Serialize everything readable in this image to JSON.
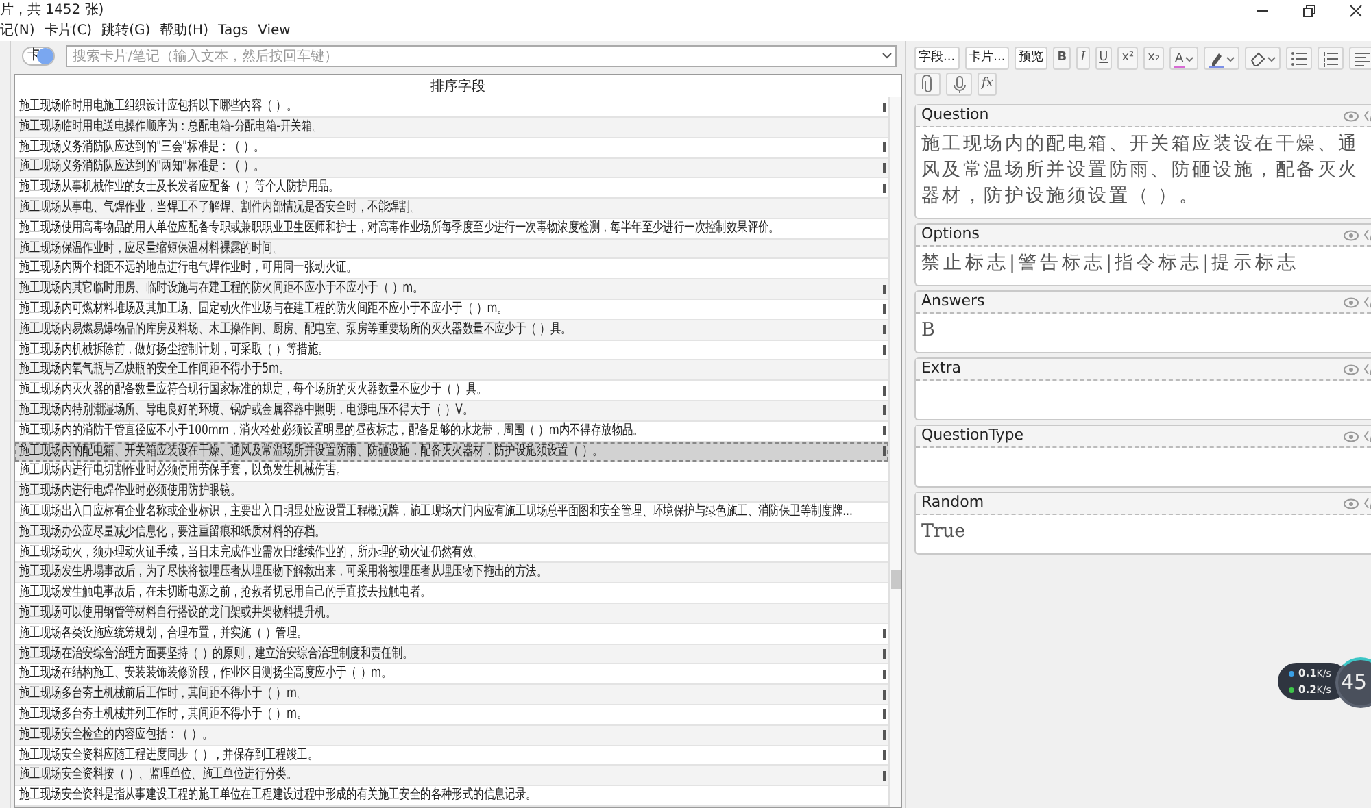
{
  "window": {
    "title": "片，共 1452 张)"
  },
  "menu": [
    {
      "label": "记(N)"
    },
    {
      "label": "卡片(C)"
    },
    {
      "label": "跳转(G)"
    },
    {
      "label": "帮助(H)"
    },
    {
      "label": "Tags"
    },
    {
      "label": "View"
    }
  ],
  "search": {
    "toggle_label": "卡",
    "placeholder": "搜索卡片/笔记（输入文本，然后按回车键）"
  },
  "table": {
    "columns": [
      "排序字段"
    ],
    "rows": [
      {
        "text": "施工现场临时用电施工组织设计应包括以下哪些内容（ ）。",
        "selected": false,
        "marked": true
      },
      {
        "text": "施工现场临时用电送电操作顺序为：总配电箱-分配电箱-开关箱。",
        "selected": false,
        "marked": false
      },
      {
        "text": "施工现场义务消防队应达到的\"三会\"标准是：（ ）。",
        "selected": false,
        "marked": true
      },
      {
        "text": "施工现场义务消防队应达到的\"两知\"标准是：（ ）。",
        "selected": false,
        "marked": true
      },
      {
        "text": "施工现场从事机械作业的女士及长发者应配备（ ）等个人防护用品。",
        "selected": false,
        "marked": true
      },
      {
        "text": "施工现场从事电、气焊作业，当焊工不了解焊、割件内部情况是否安全时，不能焊割。",
        "selected": false,
        "marked": false
      },
      {
        "text": "施工现场使用高毒物品的用人单位应配备专职或兼职职业卫生医师和护士，对高毒作业场所每季度至少进行一次毒物浓度检测，每半年至少进行一次控制效果评价。",
        "selected": false,
        "marked": false
      },
      {
        "text": "施工现场保温作业时，应尽量缩短保温材料裸露的时间。",
        "selected": false,
        "marked": false
      },
      {
        "text": "施工现场内两个相距不远的地点进行电气焊作业时，可用同一张动火证。",
        "selected": false,
        "marked": false
      },
      {
        "text": "施工现场内其它临时用房、临时设施与在建工程的防火间距不应小于不应小于（ ）m。",
        "selected": false,
        "marked": true
      },
      {
        "text": "施工现场内可燃材料堆场及其加工场、固定动火作业场与在建工程的防火间距不应小于不应小于（ ）m。",
        "selected": false,
        "marked": true
      },
      {
        "text": "施工现场内易燃易爆物品的库房及料场、木工操作间、厨房、配电室、泵房等重要场所的灭火器数量不应少于（ ）具。",
        "selected": false,
        "marked": true
      },
      {
        "text": "施工现场内机械拆除前，做好扬尘控制计划，可采取（ ）等措施。",
        "selected": false,
        "marked": true
      },
      {
        "text": "施工现场内氧气瓶与乙炔瓶的安全工作间距不得小于5m。",
        "selected": false,
        "marked": false
      },
      {
        "text": "施工现场内灭火器的配备数量应符合现行国家标准的规定，每个场所的灭火器数量不应少于（ ）具。",
        "selected": false,
        "marked": true
      },
      {
        "text": "施工现场内特别潮湿场所、导电良好的环境、锅炉或金属容器中照明，电源电压不得大于（ ）V。",
        "selected": false,
        "marked": true
      },
      {
        "text": "施工现场内的消防干管直径应不小于100mm，消火栓处必须设置明显的昼夜标志，配备足够的水龙带，周围（ ）m内不得存放物品。",
        "selected": false,
        "marked": true
      },
      {
        "text": "施工现场内的配电箱、开关箱应装设在干燥、通风及常温场所并设置防雨、防砸设施，配备灭火器材，防护设施须设置（ ）。",
        "selected": true,
        "marked": true
      },
      {
        "text": "施工现场内进行电切割作业时必须使用劳保手套，以免发生机械伤害。",
        "selected": false,
        "marked": false
      },
      {
        "text": "施工现场内进行电焊作业时必须使用防护眼镜。",
        "selected": false,
        "marked": false
      },
      {
        "text": "施工现场出入口应标有企业名称或企业标识，主要出入口明显处应设置工程概况牌，施工现场大门内应有施工现场总平面图和安全管理、环境保护与绿色施工、消防保卫等制度牌...",
        "selected": false,
        "marked": false
      },
      {
        "text": "施工现场办公应尽量减少信息化，要注重留痕和纸质材料的存档。",
        "selected": false,
        "marked": false
      },
      {
        "text": "施工现场动火，须办理动火证手续，当日未完成作业需次日继续作业的，所办理的动火证仍然有效。",
        "selected": false,
        "marked": false
      },
      {
        "text": "施工现场发生坍塌事故后，为了尽快将被埋压者从埋压物下解救出来，可采用将被埋压者从埋压物下拖出的方法。",
        "selected": false,
        "marked": false
      },
      {
        "text": "施工现场发生触电事故后，在未切断电源之前，抢救者切忌用自己的手直接去拉触电者。",
        "selected": false,
        "marked": false
      },
      {
        "text": "施工现场可以使用钢管等材料自行搭设的龙门架或井架物料提升机。",
        "selected": false,
        "marked": false
      },
      {
        "text": "施工现场各类设施应统筹规划，合理布置，并实施（ ）管理。",
        "selected": false,
        "marked": true
      },
      {
        "text": "施工现场在治安综合治理方面要坚持（ ）的原则，建立治安综合治理制度和责任制。",
        "selected": false,
        "marked": true
      },
      {
        "text": "施工现场在结构施工、安装装饰装修阶段，作业区目测扬尘高度应小于（ ）m。",
        "selected": false,
        "marked": true
      },
      {
        "text": "施工现场多台夯土机械前后工作时，其间距不得小于（ ）m。",
        "selected": false,
        "marked": true
      },
      {
        "text": "施工现场多台夯土机械并列工作时，其间距不得小于（ ）m。",
        "selected": false,
        "marked": true
      },
      {
        "text": "施工现场安全检查的内容应包括：（ ）。",
        "selected": false,
        "marked": true
      },
      {
        "text": "施工现场安全资料应随工程进度同步（ ），并保存到工程竣工。",
        "selected": false,
        "marked": true
      },
      {
        "text": "施工现场安全资料按（ ）、监理单位、施工单位进行分类。",
        "selected": false,
        "marked": true
      },
      {
        "text": "施工现场安全资料是指从事建设工程的施工单位在工程建设过程中形成的有关施工安全的各种形式的信息记录。",
        "selected": false,
        "marked": false
      }
    ]
  },
  "editor": {
    "toolbar_rows": [
      [
        {
          "kind": "button",
          "label": "字段..."
        },
        {
          "kind": "button",
          "label": "卡片..."
        },
        {
          "kind": "button",
          "label": "预览"
        },
        {
          "kind": "bold",
          "label": "B"
        },
        {
          "kind": "italic",
          "label": "I"
        },
        {
          "kind": "underline",
          "label": "U"
        },
        {
          "kind": "superscript",
          "label": "x²"
        },
        {
          "kind": "subscript",
          "label": "x₂"
        },
        {
          "kind": "text_color",
          "label": "A"
        },
        {
          "kind": "highlight"
        },
        {
          "kind": "eraser"
        },
        {
          "kind": "bullet_list"
        },
        {
          "kind": "numbered_list"
        },
        {
          "kind": "align"
        }
      ],
      [
        {
          "kind": "attach"
        },
        {
          "kind": "record"
        },
        {
          "kind": "formula",
          "label": "fx"
        }
      ]
    ],
    "fields": [
      {
        "name": "Question",
        "value": "施工现场内的配电箱、开关箱应装设在干燥、通风及常温场所并设置防雨、防砸设施，配备灭火器材，防护设施须设置（ ）。"
      },
      {
        "name": "Options",
        "value": "禁止标志|警告标志|指令标志|提示标志"
      },
      {
        "name": "Answers",
        "value": "B"
      },
      {
        "name": "Extra"
      },
      {
        "name": "QuestionType"
      },
      {
        "name": "Random",
        "value": "True"
      }
    ]
  },
  "network_widget": {
    "upload": {
      "value": "0.1",
      "unit": "K/s"
    },
    "download": {
      "value": "0.2",
      "unit": "K/s"
    },
    "percent": "45"
  }
}
